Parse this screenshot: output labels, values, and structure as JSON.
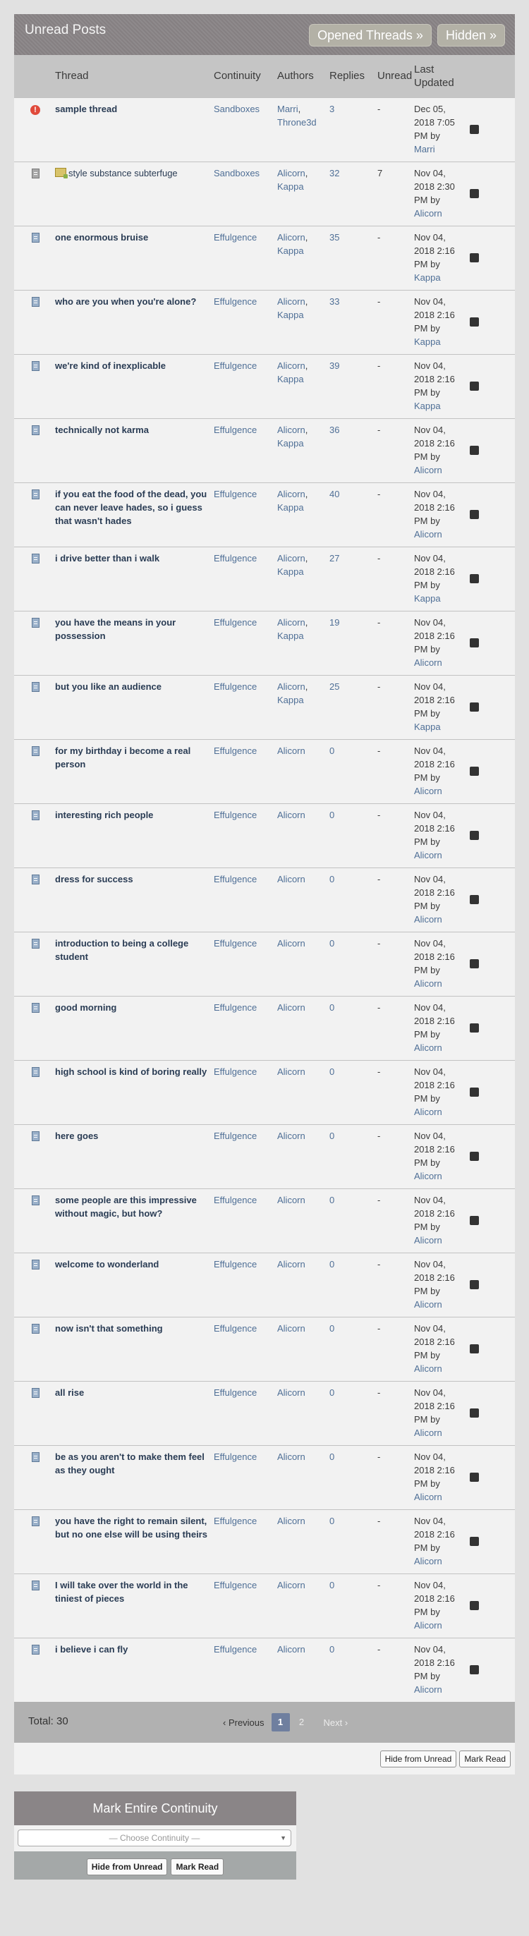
{
  "panel": {
    "title": "Unread Posts",
    "buttons": {
      "opened_threads": "Opened Threads »",
      "hidden": "Hidden »"
    }
  },
  "columns": {
    "thread": "Thread",
    "continuity": "Continuity",
    "authors": "Authors",
    "replies": "Replies",
    "unread": "Unread",
    "last_updated": "Last Updated"
  },
  "rows": [
    {
      "icon": "alert-icon",
      "title": "sample thread",
      "continuity": "Sandboxes",
      "authors": [
        "Marri",
        "Throne3d"
      ],
      "replies": "3",
      "unread": "-",
      "updated": "Dec 05, 2018 7:05 PM by",
      "updated_by": "Marri"
    },
    {
      "icon": "grey-doc-icon",
      "title_icon": "draft-icon",
      "title": "style substance subterfuge",
      "title_style": "normal",
      "continuity": "Sandboxes",
      "authors": [
        "Alicorn",
        "Kappa"
      ],
      "replies": "32",
      "unread": "7",
      "updated": "Nov 04, 2018 2:30 PM by",
      "updated_by": "Alicorn"
    },
    {
      "icon": "doc-icon",
      "title": "one enormous bruise",
      "continuity": "Effulgence",
      "authors": [
        "Alicorn",
        "Kappa"
      ],
      "replies": "35",
      "unread": "-",
      "updated": "Nov 04, 2018 2:16 PM by",
      "updated_by": "Kappa"
    },
    {
      "icon": "doc-icon",
      "title": "who are you when you're alone?",
      "continuity": "Effulgence",
      "authors": [
        "Alicorn",
        "Kappa"
      ],
      "replies": "33",
      "unread": "-",
      "updated": "Nov 04, 2018 2:16 PM by",
      "updated_by": "Kappa"
    },
    {
      "icon": "doc-icon",
      "title": "we're kind of inexplicable",
      "continuity": "Effulgence",
      "authors": [
        "Alicorn",
        "Kappa"
      ],
      "replies": "39",
      "unread": "-",
      "updated": "Nov 04, 2018 2:16 PM by",
      "updated_by": "Kappa"
    },
    {
      "icon": "doc-icon",
      "title": "technically not karma",
      "continuity": "Effulgence",
      "authors": [
        "Alicorn",
        "Kappa"
      ],
      "replies": "36",
      "unread": "-",
      "updated": "Nov 04, 2018 2:16 PM by",
      "updated_by": "Alicorn"
    },
    {
      "icon": "doc-icon",
      "title": "if you eat the food of the dead, you can never leave hades, so i guess that wasn't hades",
      "continuity": "Effulgence",
      "authors": [
        "Alicorn",
        "Kappa"
      ],
      "replies": "40",
      "unread": "-",
      "updated": "Nov 04, 2018 2:16 PM by",
      "updated_by": "Alicorn"
    },
    {
      "icon": "doc-icon",
      "title": "i drive better than i walk",
      "continuity": "Effulgence",
      "authors": [
        "Alicorn",
        "Kappa"
      ],
      "replies": "27",
      "unread": "-",
      "updated": "Nov 04, 2018 2:16 PM by",
      "updated_by": "Kappa"
    },
    {
      "icon": "doc-icon",
      "title": "you have the means in your possession",
      "continuity": "Effulgence",
      "authors": [
        "Alicorn",
        "Kappa"
      ],
      "replies": "19",
      "unread": "-",
      "updated": "Nov 04, 2018 2:16 PM by",
      "updated_by": "Alicorn"
    },
    {
      "icon": "doc-icon",
      "title": "but you like an audience",
      "continuity": "Effulgence",
      "authors": [
        "Alicorn",
        "Kappa"
      ],
      "replies": "25",
      "unread": "-",
      "updated": "Nov 04, 2018 2:16 PM by",
      "updated_by": "Kappa"
    },
    {
      "icon": "doc-icon",
      "title": "for my birthday i become a real person",
      "continuity": "Effulgence",
      "authors": [
        "Alicorn"
      ],
      "replies": "0",
      "unread": "-",
      "updated": "Nov 04, 2018 2:16 PM by",
      "updated_by": "Alicorn"
    },
    {
      "icon": "doc-icon",
      "title": "interesting rich people",
      "continuity": "Effulgence",
      "authors": [
        "Alicorn"
      ],
      "replies": "0",
      "unread": "-",
      "updated": "Nov 04, 2018 2:16 PM by",
      "updated_by": "Alicorn"
    },
    {
      "icon": "doc-icon",
      "title": "dress for success",
      "continuity": "Effulgence",
      "authors": [
        "Alicorn"
      ],
      "replies": "0",
      "unread": "-",
      "updated": "Nov 04, 2018 2:16 PM by",
      "updated_by": "Alicorn"
    },
    {
      "icon": "doc-icon",
      "title": "introduction to being a college student",
      "continuity": "Effulgence",
      "authors": [
        "Alicorn"
      ],
      "replies": "0",
      "unread": "-",
      "updated": "Nov 04, 2018 2:16 PM by",
      "updated_by": "Alicorn"
    },
    {
      "icon": "doc-icon",
      "title": "good morning",
      "continuity": "Effulgence",
      "authors": [
        "Alicorn"
      ],
      "replies": "0",
      "unread": "-",
      "updated": "Nov 04, 2018 2:16 PM by",
      "updated_by": "Alicorn"
    },
    {
      "icon": "doc-icon",
      "title": "high school is kind of boring really",
      "continuity": "Effulgence",
      "authors": [
        "Alicorn"
      ],
      "replies": "0",
      "unread": "-",
      "updated": "Nov 04, 2018 2:16 PM by",
      "updated_by": "Alicorn"
    },
    {
      "icon": "doc-icon",
      "title": "here goes",
      "continuity": "Effulgence",
      "authors": [
        "Alicorn"
      ],
      "replies": "0",
      "unread": "-",
      "updated": "Nov 04, 2018 2:16 PM by",
      "updated_by": "Alicorn"
    },
    {
      "icon": "doc-icon",
      "title": "some people are this impressive without magic, but how?",
      "continuity": "Effulgence",
      "authors": [
        "Alicorn"
      ],
      "replies": "0",
      "unread": "-",
      "updated": "Nov 04, 2018 2:16 PM by",
      "updated_by": "Alicorn"
    },
    {
      "icon": "doc-icon",
      "title": "welcome to wonderland",
      "continuity": "Effulgence",
      "authors": [
        "Alicorn"
      ],
      "replies": "0",
      "unread": "-",
      "updated": "Nov 04, 2018 2:16 PM by",
      "updated_by": "Alicorn"
    },
    {
      "icon": "doc-icon",
      "title": "now isn't that something",
      "continuity": "Effulgence",
      "authors": [
        "Alicorn"
      ],
      "replies": "0",
      "unread": "-",
      "updated": "Nov 04, 2018 2:16 PM by",
      "updated_by": "Alicorn"
    },
    {
      "icon": "doc-icon",
      "title": "all rise",
      "continuity": "Effulgence",
      "authors": [
        "Alicorn"
      ],
      "replies": "0",
      "unread": "-",
      "updated": "Nov 04, 2018 2:16 PM by",
      "updated_by": "Alicorn"
    },
    {
      "icon": "doc-icon",
      "title": "be as you aren't to make them feel as they ought",
      "continuity": "Effulgence",
      "authors": [
        "Alicorn"
      ],
      "replies": "0",
      "unread": "-",
      "updated": "Nov 04, 2018 2:16 PM by",
      "updated_by": "Alicorn"
    },
    {
      "icon": "doc-icon",
      "title": "you have the right to remain silent, but no one else will be using theirs",
      "continuity": "Effulgence",
      "authors": [
        "Alicorn"
      ],
      "replies": "0",
      "unread": "-",
      "updated": "Nov 04, 2018 2:16 PM by",
      "updated_by": "Alicorn"
    },
    {
      "icon": "doc-icon",
      "title": "I will take over the world in the tiniest of pieces",
      "continuity": "Effulgence",
      "authors": [
        "Alicorn"
      ],
      "replies": "0",
      "unread": "-",
      "updated": "Nov 04, 2018 2:16 PM by",
      "updated_by": "Alicorn"
    },
    {
      "icon": "doc-icon",
      "title": "i believe i can fly",
      "continuity": "Effulgence",
      "authors": [
        "Alicorn"
      ],
      "replies": "0",
      "unread": "-",
      "updated": "Nov 04, 2018 2:16 PM by",
      "updated_by": "Alicorn"
    }
  ],
  "footer": {
    "total": "Total: 30",
    "pagination": {
      "previous": "‹ Previous",
      "pages": [
        "1",
        "2"
      ],
      "current": "1",
      "next": "Next ›"
    }
  },
  "actions": {
    "hide_from_unread": "Hide from Unread",
    "mark_read": "Mark Read"
  },
  "mark_continuity": {
    "title": "Mark Entire Continuity",
    "select_placeholder": "— Choose Continuity —",
    "hide_from_unread": "Hide from Unread",
    "mark_read": "Mark Read"
  }
}
